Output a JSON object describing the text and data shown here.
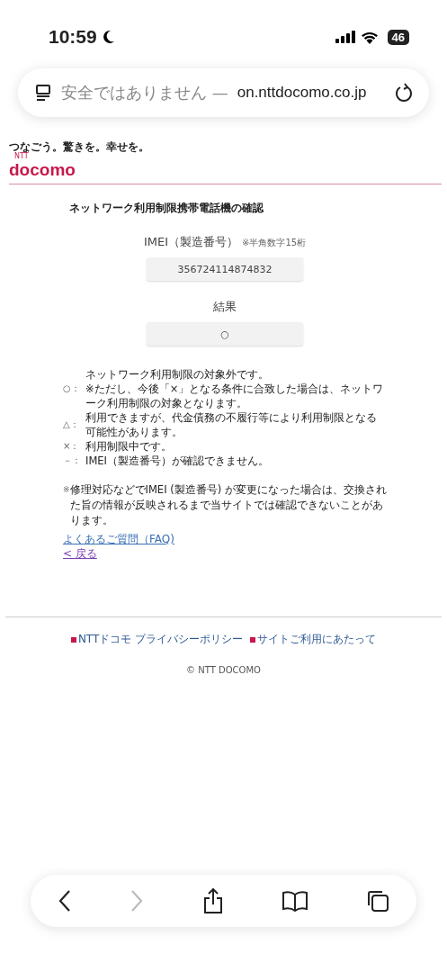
{
  "status_bar": {
    "time": "10:59",
    "battery": "46"
  },
  "address_bar": {
    "security": "安全ではありません —",
    "url": "on.nttdocomo.co.jp"
  },
  "logo": {
    "tagline": "つなごう。驚きを。幸せを。",
    "brand_small": "NTT",
    "brand": "docomo"
  },
  "title": "ネットワーク利用制限携帯電話機の確認",
  "imei": {
    "label": "IMEI（製造番号）",
    "hint": "※半角数字15桁",
    "value": "356724114874832"
  },
  "result": {
    "label": "結果",
    "value": "○"
  },
  "legend": [
    {
      "symbol": "○：",
      "text": "ネットワーク利用制限の対象外です。",
      "note": "※ただし、今後「×」となる条件に合致した場合は、ネットワーク利用制限の対象となります。"
    },
    {
      "symbol": "△：",
      "text": "利用できますが、代金債務の不履行等により利用制限となる可能性があります。"
    },
    {
      "symbol": "×：",
      "text": "利用制限中です。"
    },
    {
      "symbol": "－：",
      "text": "IMEI（製造番号）が確認できません。"
    }
  ],
  "notice": {
    "mark": "※",
    "text": "修理対応などでIMEI (製造番号) が変更になった場合は、交換された旨の情報が反映されるまで当サイトでは確認できないことがあります。"
  },
  "links": [
    {
      "label": "よくあるご質問（FAQ)"
    },
    {
      "label": "< 戻る"
    }
  ],
  "footer": {
    "links": [
      "NTTドコモ プライバシーポリシー",
      "サイトご利用にあたって"
    ],
    "copyright": "© NTT DOCOMO"
  }
}
